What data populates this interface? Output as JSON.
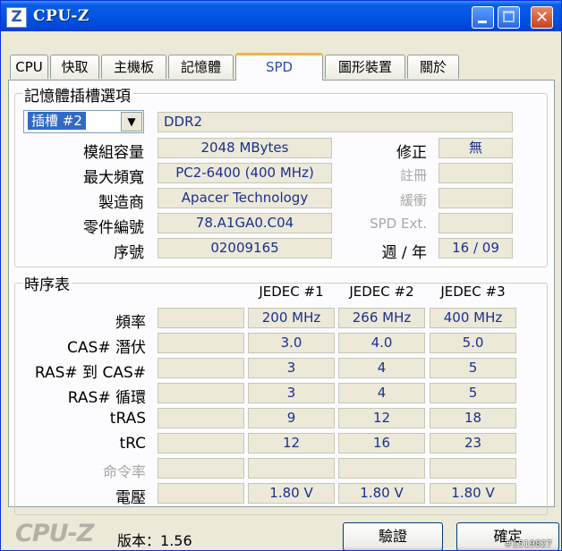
{
  "window": {
    "app_letter": "Z",
    "title": "CPU-Z"
  },
  "tabs": [
    "CPU",
    "快取",
    "主機板",
    "記憶體",
    "SPD",
    "圖形裝置",
    "關於"
  ],
  "active_tab": "SPD",
  "slot_group": {
    "title": "記憶體插槽選項",
    "slot_selected": "插槽 #2",
    "memory_type": "DDR2",
    "rows": [
      {
        "label": "模組容量",
        "value": "2048 MBytes"
      },
      {
        "label": "最大頻寬",
        "value": "PC2-6400 (400 MHz)"
      },
      {
        "label": "製造商",
        "value": "Apacer Technology"
      },
      {
        "label": "零件編號",
        "value": "78.A1GA0.C04"
      },
      {
        "label": "序號",
        "value": "02009165"
      }
    ],
    "right": [
      {
        "label": "修正",
        "value": "無",
        "dim": false
      },
      {
        "label": "註冊",
        "value": "",
        "dim": true
      },
      {
        "label": "緩衝",
        "value": "",
        "dim": true
      },
      {
        "label": "SPD Ext.",
        "value": "",
        "dim": true
      },
      {
        "label": "週 / 年",
        "value": "16 / 09",
        "dim": false
      }
    ]
  },
  "timing": {
    "title": "時序表",
    "columns": [
      "JEDEC #1",
      "JEDEC #2",
      "JEDEC #3"
    ],
    "rows": [
      {
        "label": "頻率",
        "dim": false,
        "values": [
          "200 MHz",
          "266 MHz",
          "400 MHz"
        ]
      },
      {
        "label": "CAS# 潛伏",
        "dim": false,
        "values": [
          "3.0",
          "4.0",
          "5.0"
        ]
      },
      {
        "label": "RAS# 到 CAS#",
        "dim": false,
        "values": [
          "3",
          "4",
          "5"
        ]
      },
      {
        "label": "RAS# 循環",
        "dim": false,
        "values": [
          "3",
          "4",
          "5"
        ]
      },
      {
        "label": "tRAS",
        "dim": false,
        "values": [
          "9",
          "12",
          "18"
        ]
      },
      {
        "label": "tRC",
        "dim": false,
        "values": [
          "12",
          "16",
          "23"
        ]
      },
      {
        "label": "命令率",
        "dim": true,
        "values": [
          "",
          "",
          ""
        ]
      },
      {
        "label": "電壓",
        "dim": false,
        "values": [
          "1.80 V",
          "1.80 V",
          "1.80 V"
        ]
      }
    ]
  },
  "footer": {
    "logo": "CPU-Z",
    "version_label": "版本：",
    "version": "1.56",
    "validate_button": "驗證",
    "ok_button": "確定",
    "watermark": "#1519827"
  }
}
